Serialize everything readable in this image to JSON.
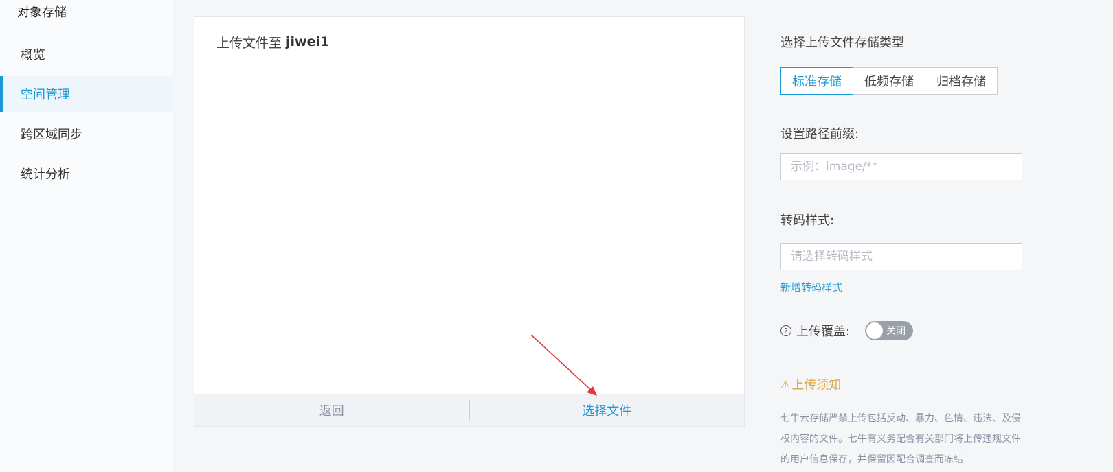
{
  "sidebar": {
    "brand": "对象存储",
    "items": [
      {
        "label": "概览",
        "active": false
      },
      {
        "label": "空间管理",
        "active": true
      },
      {
        "label": "跨区域同步",
        "active": false
      },
      {
        "label": "统计分析",
        "active": false
      }
    ]
  },
  "panel": {
    "title_prefix": "上传文件至",
    "bucket_name": "jiwei1",
    "back_label": "返回",
    "choose_label": "选择文件"
  },
  "settings": {
    "storage_type_label": "选择上传文件存储类型",
    "storage_types": [
      "标准存储",
      "低频存储",
      "归档存储"
    ],
    "selected_storage_type": "标准存储",
    "prefix_label": "设置路径前缀:",
    "prefix_value": "",
    "prefix_placeholder": "示例：image/**",
    "transcode_label": "转码样式:",
    "transcode_value": "",
    "transcode_placeholder": "请选择转码样式",
    "add_transcode_link": "新增转码样式",
    "overwrite_label": "上传覆盖:",
    "overwrite_state": "关闭",
    "notice_title": "上传须知",
    "notice_text": "七牛云存储严禁上传包括反动、暴力、色情、违法、及侵权内容的文件。七牛有义务配合有关部门将上传违规文件的用户信息保存，并保留因配合调查而冻结"
  },
  "colors": {
    "accent": "#1a9ad6",
    "warning": "#d9a545",
    "annotation_arrow": "#e8383d"
  }
}
